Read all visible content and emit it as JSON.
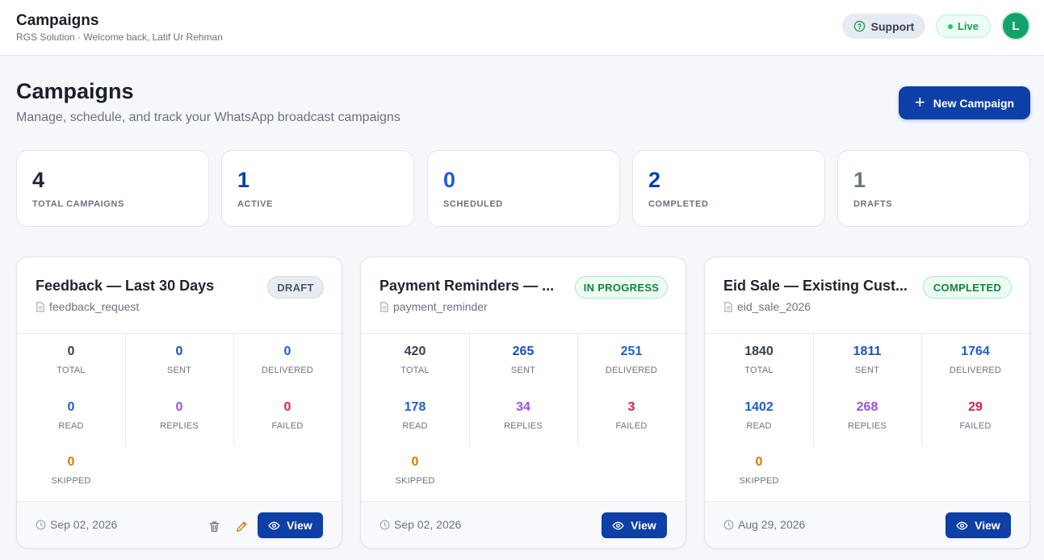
{
  "header": {
    "title": "Campaigns",
    "subtitle": "RGS Solution · Welcome back, Latif Ur Rehman",
    "support_label": "Support",
    "live_label": "Live",
    "avatar_initial": "L"
  },
  "page": {
    "title": "Campaigns",
    "subtitle": "Manage, schedule, and track your WhatsApp broadcast campaigns",
    "new_button_label": "New Campaign"
  },
  "stats": [
    {
      "value": "4",
      "label": "TOTAL CAMPAIGNS",
      "color": "#1f2430"
    },
    {
      "value": "1",
      "label": "ACTIVE",
      "color": "#0d3fa6"
    },
    {
      "value": "0",
      "label": "SCHEDULED",
      "color": "#1d5fd0"
    },
    {
      "value": "2",
      "label": "COMPLETED",
      "color": "#0d3fa6"
    },
    {
      "value": "1",
      "label": "DRAFTS",
      "color": "#6b7280"
    }
  ],
  "metric_labels": {
    "total": "TOTAL",
    "sent": "SENT",
    "delivered": "DELIVERED",
    "read": "READ",
    "replies": "REPLIES",
    "failed": "FAILED",
    "skipped": "SKIPPED"
  },
  "metric_colors": {
    "total": "#374151",
    "sent": "#1d4fb8",
    "delivered": "#1d5fd0",
    "read": "#1d5fd0",
    "replies": "#9b51e0",
    "failed": "#e11d48",
    "skipped": "#d97706"
  },
  "campaigns": [
    {
      "name": "Feedback — Last 30 Days",
      "template": "feedback_request",
      "status": "DRAFT",
      "metrics": {
        "total": "0",
        "sent": "0",
        "delivered": "0",
        "read": "0",
        "replies": "0",
        "failed": "0",
        "skipped": "0"
      },
      "date": "Sep 02, 2026",
      "view_label": "View"
    },
    {
      "name": "Payment Reminders — ...",
      "template": "payment_reminder",
      "status": "IN PROGRESS",
      "metrics": {
        "total": "420",
        "sent": "265",
        "delivered": "251",
        "read": "178",
        "replies": "34",
        "failed": "3",
        "skipped": "0"
      },
      "date": "Sep 02, 2026",
      "view_label": "View"
    },
    {
      "name": "Eid Sale — Existing Cust...",
      "template": "eid_sale_2026",
      "status": "COMPLETED",
      "metrics": {
        "total": "1840",
        "sent": "1811",
        "delivered": "1764",
        "read": "1402",
        "replies": "268",
        "failed": "29",
        "skipped": "0"
      },
      "date": "Aug 29, 2026",
      "view_label": "View"
    }
  ]
}
